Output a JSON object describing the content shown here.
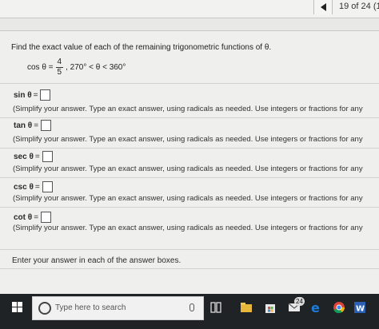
{
  "nav": {
    "counter": "19 of 24 (1"
  },
  "problem": {
    "instruction": "Find the exact value of each of the remaining trigonometric functions of θ.",
    "given_lhs": "cos θ =",
    "given_num": "4",
    "given_den": "5",
    "given_condition": ", 270° < θ < 360°"
  },
  "questions": [
    {
      "func": "sin",
      "hint": "(Simplify your answer. Type an exact answer, using radicals as needed. Use integers or fractions for any"
    },
    {
      "func": "tan",
      "hint": "(Simplify your answer. Type an exact answer, using radicals as needed. Use integers or fractions for any"
    },
    {
      "func": "sec",
      "hint": "(Simplify your answer. Type an exact answer, using radicals as needed. Use integers or fractions for any"
    },
    {
      "func": "csc",
      "hint": "(Simplify your answer. Type an exact answer, using radicals as needed. Use integers or fractions for any"
    },
    {
      "func": "cot",
      "hint": "(Simplify your answer. Type an exact answer, using radicals as needed. Use integers or fractions for any"
    }
  ],
  "symbols": {
    "theta": "θ",
    "equals": "="
  },
  "footer": {
    "text": "Enter your answer in each of the answer boxes."
  },
  "taskbar": {
    "search_placeholder": "Type here to search",
    "mail_badge": "24",
    "icons": [
      "windows-logo-icon",
      "cortana-circle-icon",
      "microphone-icon",
      "task-view-icon",
      "file-explorer-icon",
      "store-icon",
      "mail-icon",
      "edge-icon",
      "chrome-icon",
      "word-icon"
    ]
  },
  "colors": {
    "taskbar": "#1f2326",
    "edge_blue": "#1e7bd6",
    "word_blue": "#2b5fb3"
  }
}
